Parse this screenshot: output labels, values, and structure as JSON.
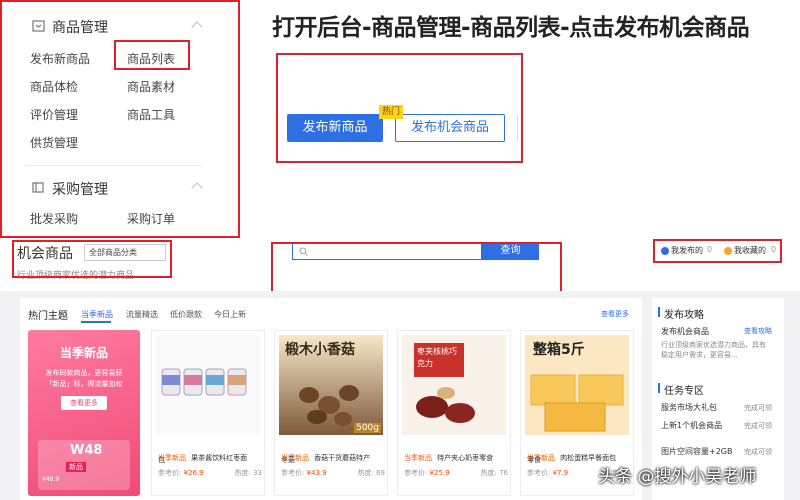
{
  "headline": "打开后台-商品管理-商品列表-点击发布机会商品",
  "sidebar": {
    "group1": {
      "title": "商品管理",
      "items": [
        "发布新商品",
        "商品列表",
        "商品体检",
        "商品素材",
        "评价管理",
        "商品工具",
        "供货管理"
      ]
    },
    "group2": {
      "title": "采购管理",
      "items": [
        "批发采购",
        "采购订单"
      ]
    }
  },
  "publish": {
    "new_label": "发布新商品",
    "opp_label": "发布机会商品",
    "hot_badge": "热门"
  },
  "strip": {
    "title": "机会商品",
    "category_select": "全部商品分类",
    "subtitle": "行业顶级商家优选的潜力商品",
    "search_button": "查询",
    "my_published": "我发布的",
    "my_published_count": "0",
    "my_favorites": "我收藏的",
    "my_favorites_count": "0"
  },
  "hot": {
    "title": "热门主题",
    "tabs": [
      "当季新品",
      "流量精选",
      "低价跟款",
      "今日上新"
    ],
    "more": "查看更多",
    "promo": {
      "title": "当季新品",
      "desc1": "发布同款商品，更容易获",
      "desc2": "「新品」标，得流量加权",
      "button": "查看更多",
      "badge_num": "W48",
      "badge_tag": "新品",
      "price_bits": "¥48.9"
    },
    "products": [
      {
        "tag": "当季新品",
        "name": "果茶酱饮料红枣面",
        "name2": "包",
        "price_label": "参考价:",
        "price": "¥26.9",
        "heat_label": "热度:",
        "heat": "33",
        "img_text": ""
      },
      {
        "tag": "当季新品",
        "name": "香菇干货蘑菇特产",
        "name2": "冬菇",
        "price_label": "参考价:",
        "price": "¥43.9",
        "heat_label": "热度:",
        "heat": "69",
        "img_text": "椴木小香菇",
        "img_text2": "500g"
      },
      {
        "tag": "当季新品",
        "name": "特产夹心奶枣零食",
        "name2": "",
        "price_label": "参考价:",
        "price": "¥25.9",
        "heat_label": "热度:",
        "heat": "76",
        "img_text": "枣夹核桃巧克力"
      },
      {
        "tag": "当季新品",
        "name": "肉松蛋糕早餐面包",
        "name2": "零食",
        "price_label": "参考价:",
        "price": "¥7.9",
        "heat_label": "热度:",
        "heat": "40",
        "img_text": "整箱5斤"
      }
    ]
  },
  "right": {
    "guide_title": "发布攻略",
    "guide_item": "发布机会商品",
    "guide_link": "查看攻略",
    "guide_desc1": "行业顶级商家优选潜力商品，具有",
    "guide_desc2": "稳定用户需求，更容易...",
    "task_title": "任务专区",
    "task1": "服务市场大礼包",
    "task1_status": "完成可领",
    "task2": "上新1个机会商品",
    "task2_status": "完成可领",
    "task3": "图片空间容量+2GB",
    "task3_status": "完成可领"
  },
  "watermark": "头条 @搜外小吴老师",
  "colors": {
    "accent": "#2f6fe4",
    "highlight": "#e0202a",
    "promo": "#f04a78",
    "tag": "#ff5a00"
  }
}
